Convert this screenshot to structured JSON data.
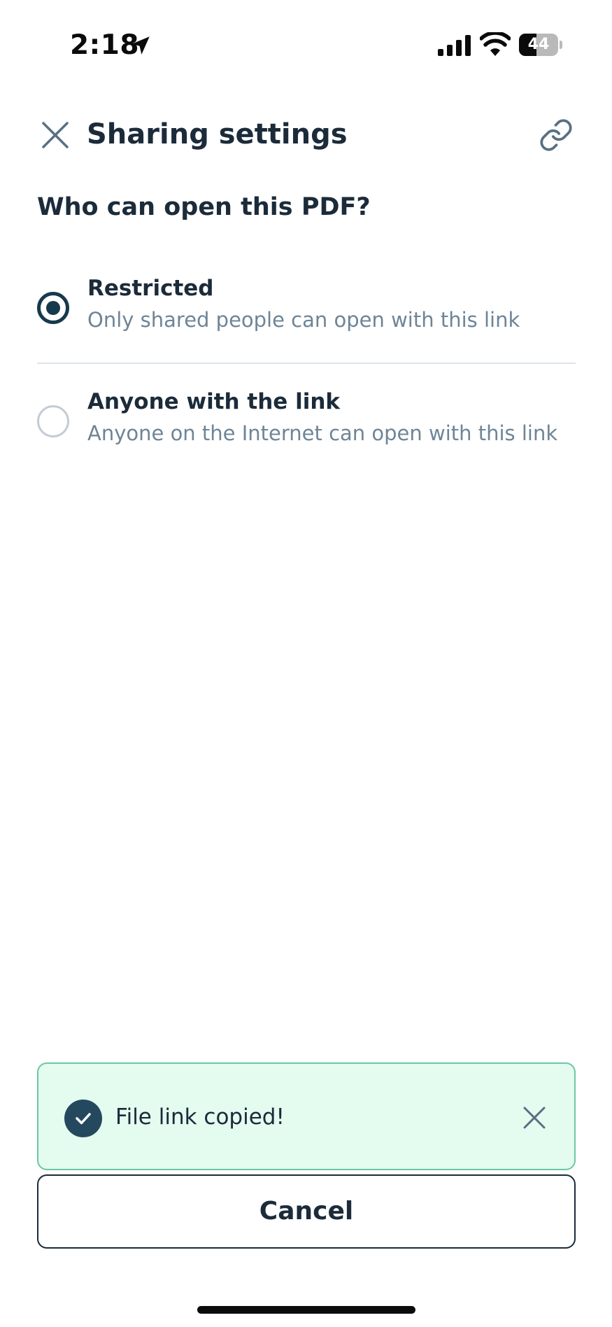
{
  "status_bar": {
    "time": "2:18",
    "battery_level": "44",
    "battery_percent": 44,
    "icons": [
      "location-arrow-icon",
      "cellular-signal-icon",
      "wifi-icon",
      "battery-icon"
    ]
  },
  "header": {
    "title": "Sharing settings",
    "close_icon": "close-icon",
    "link_icon": "link-icon"
  },
  "question": "Who can open this PDF?",
  "options": [
    {
      "label": "Restricted",
      "description": "Only shared people can open with this link",
      "selected": true
    },
    {
      "label": "Anyone with the link",
      "description": "Anyone on the Internet can open with this link",
      "selected": false
    }
  ],
  "toast": {
    "message": "File link copied!",
    "icon": "check-circle-icon",
    "close_icon": "close-icon"
  },
  "cancel_label": "Cancel",
  "colors": {
    "primary": "#163a4d",
    "text": "#1b2b3a",
    "muted_text": "#6e8597",
    "toast_bg": "#e4fbef",
    "toast_border": "#6cc8a4",
    "radio_unselected": "#c3ccd6"
  }
}
